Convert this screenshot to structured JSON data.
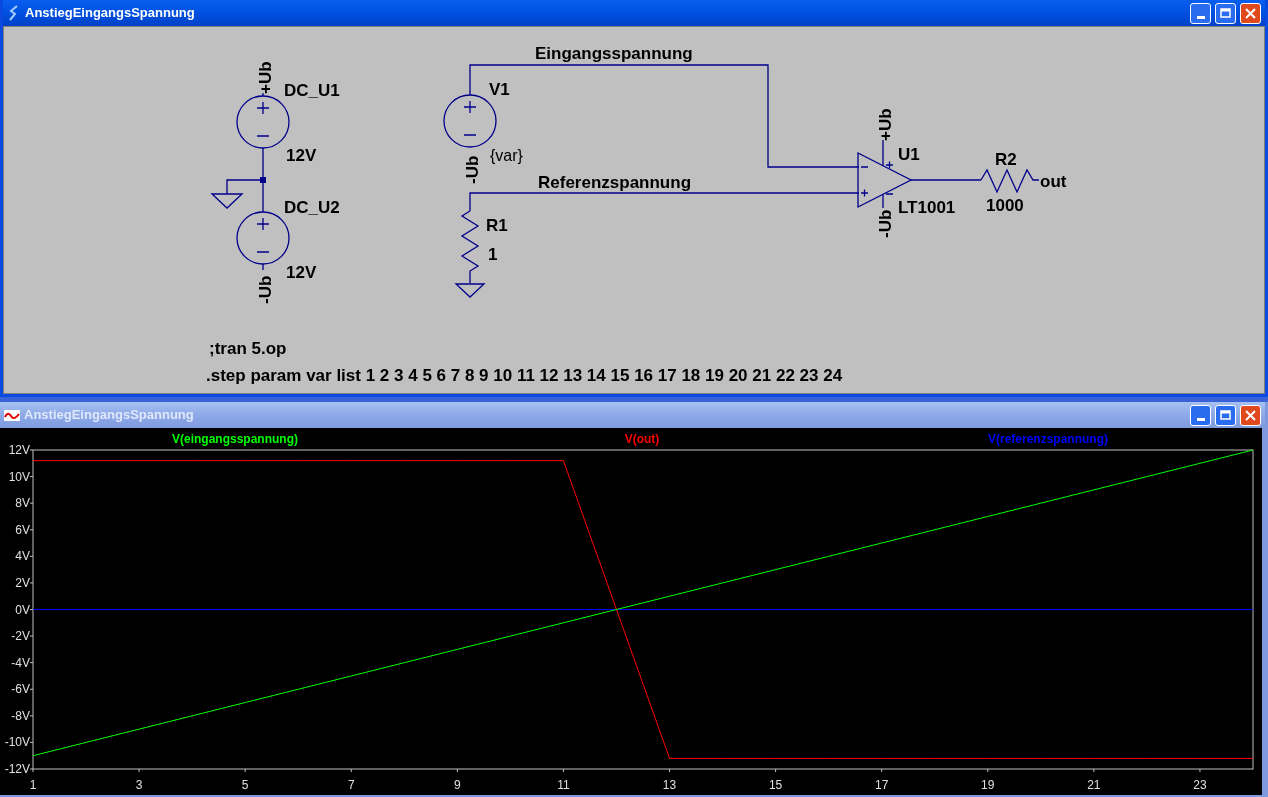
{
  "schematic_window": {
    "title": "AnstiegEingangsSpannung",
    "active": true
  },
  "schematic": {
    "dc_u1": {
      "supply": "+Ub",
      "name": "DC_U1",
      "value": "12V"
    },
    "dc_u2": {
      "supply": "-Ub",
      "name": "DC_U2",
      "value": "12V"
    },
    "v1": {
      "supply": "-Ub",
      "name": "V1",
      "value": "{var}"
    },
    "r1": {
      "name": "R1",
      "value": "1"
    },
    "u1": {
      "name": "U1",
      "value": "LT1001",
      "supply_pos": "+Ub",
      "supply_neg": "-Ub"
    },
    "r2": {
      "name": "R2",
      "value": "1000"
    },
    "net_labels": [
      "Eingangsspannung",
      "Referenzspannung",
      "out"
    ],
    "directives": [
      ";tran 5.op",
      ".step param var list 1 2 3 4 5 6 7 8 9 10 11 12 13 14 15 16 17 18 19 20 21 22 23 24"
    ]
  },
  "plot_window": {
    "title": "AnstiegEingangsSpannung",
    "active": false,
    "chart_data": {
      "type": "line",
      "x": [
        1,
        2,
        3,
        4,
        5,
        6,
        7,
        8,
        9,
        10,
        11,
        12,
        13,
        14,
        15,
        16,
        17,
        18,
        19,
        20,
        21,
        22,
        23,
        24
      ],
      "series": [
        {
          "name": "V(eingangsspannung)",
          "color": "#00ff00",
          "values": [
            -11,
            -10,
            -9,
            -8,
            -7,
            -6,
            -5,
            -4,
            -3,
            -2,
            -1,
            0,
            1,
            2,
            3,
            4,
            5,
            6,
            7,
            8,
            9,
            10,
            11,
            12
          ]
        },
        {
          "name": "V(out)",
          "color": "#ff0000",
          "values": [
            11.2,
            11.2,
            11.2,
            11.2,
            11.2,
            11.2,
            11.2,
            11.2,
            11.2,
            11.2,
            11.2,
            0,
            -11.2,
            -11.2,
            -11.2,
            -11.2,
            -11.2,
            -11.2,
            -11.2,
            -11.2,
            -11.2,
            -11.2,
            -11.2,
            -11.2
          ]
        },
        {
          "name": "V(referenzspannung)",
          "color": "#0000ff",
          "values": [
            0,
            0,
            0,
            0,
            0,
            0,
            0,
            0,
            0,
            0,
            0,
            0,
            0,
            0,
            0,
            0,
            0,
            0,
            0,
            0,
            0,
            0,
            0,
            0
          ]
        }
      ],
      "xlim": [
        1,
        24
      ],
      "ylim": [
        -12,
        12
      ],
      "xticks": [
        1,
        3,
        5,
        7,
        9,
        11,
        13,
        15,
        17,
        19,
        21,
        23
      ],
      "yticks": [
        {
          "value": 12,
          "label": "12V"
        },
        {
          "value": 10,
          "label": "10V"
        },
        {
          "value": 8,
          "label": "8V"
        },
        {
          "value": 6,
          "label": "6V"
        },
        {
          "value": 4,
          "label": "4V"
        },
        {
          "value": 2,
          "label": "2V"
        },
        {
          "value": 0,
          "label": "0V"
        },
        {
          "value": -2,
          "label": "-2V"
        },
        {
          "value": -4,
          "label": "-4V"
        },
        {
          "value": -6,
          "label": "-6V"
        },
        {
          "value": -8,
          "label": "-8V"
        },
        {
          "value": -10,
          "label": "-10V"
        },
        {
          "value": -12,
          "label": "-12V"
        }
      ]
    }
  }
}
